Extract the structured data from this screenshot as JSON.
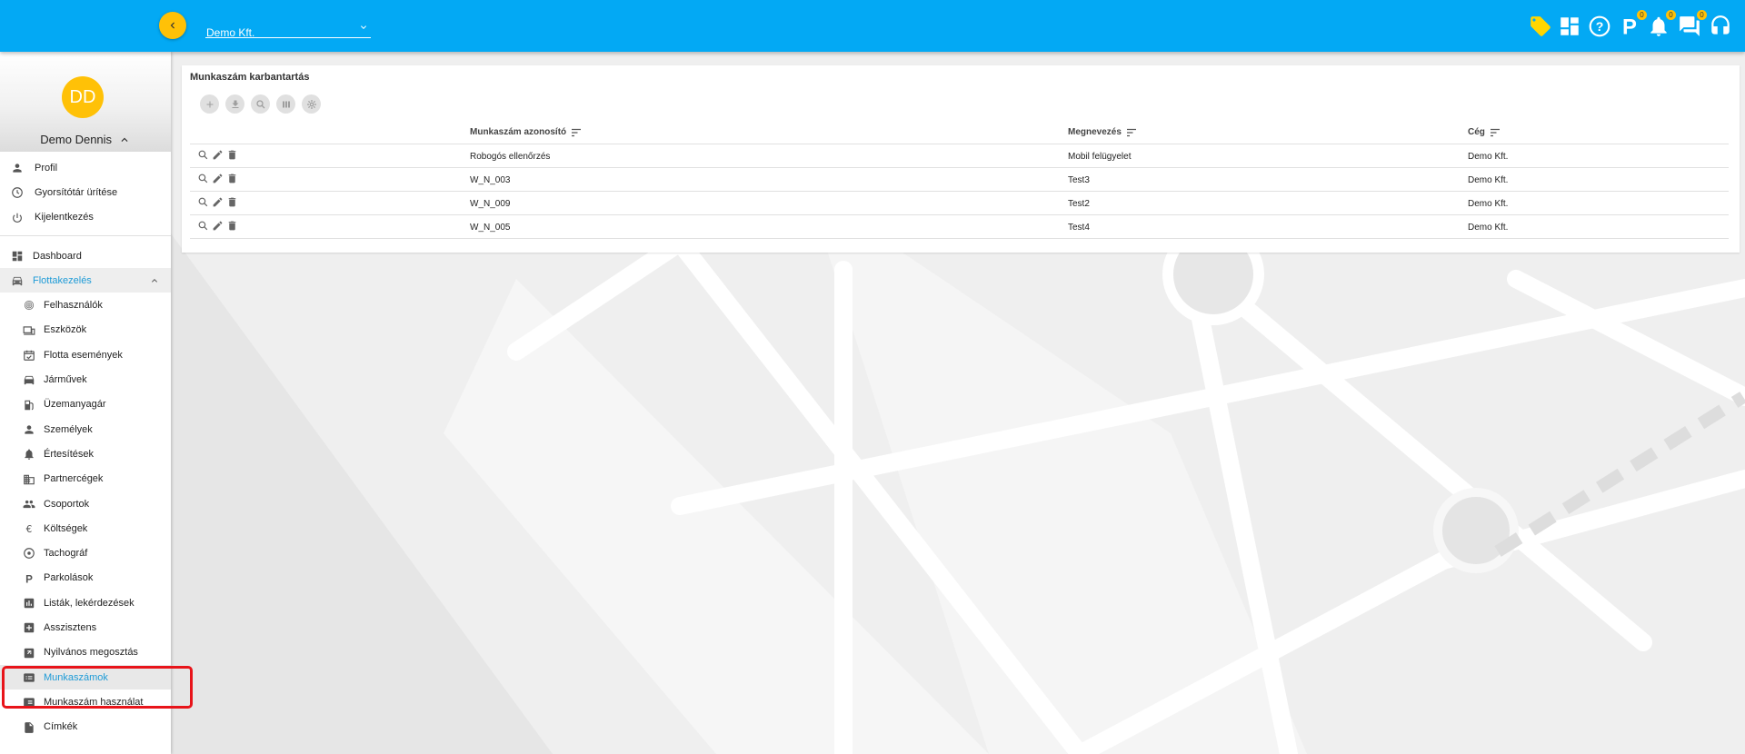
{
  "header": {
    "company_value": "Demo Kft.",
    "badges": {
      "parking": "0",
      "notifications": "0",
      "messages": "0"
    },
    "accent_color": "#03a9f4",
    "highlight_color": "#ffc107"
  },
  "user": {
    "initials": "DD",
    "name": "Demo Dennis"
  },
  "sidebar": {
    "account_items": [
      {
        "label": "Profil",
        "icon": "person-icon"
      },
      {
        "label": "Gyorsítótár ürítése",
        "icon": "clock-icon"
      },
      {
        "label": "Kijelentkezés",
        "icon": "power-icon"
      }
    ],
    "dashboard": "Dashboard",
    "section_title": "Flottakezelés",
    "items": [
      {
        "label": "Felhasználók",
        "icon": "fingerprint-icon"
      },
      {
        "label": "Eszközök",
        "icon": "devices-icon"
      },
      {
        "label": "Flotta események",
        "icon": "calendar-check-icon"
      },
      {
        "label": "Járművek",
        "icon": "car-icon"
      },
      {
        "label": "Üzemanyagár",
        "icon": "fuel-icon"
      },
      {
        "label": "Személyek",
        "icon": "person-icon"
      },
      {
        "label": "Értesítések",
        "icon": "alarm-icon"
      },
      {
        "label": "Partnercégek",
        "icon": "business-icon"
      },
      {
        "label": "Csoportok",
        "icon": "group-icon"
      },
      {
        "label": "Költségek",
        "icon": "euro-icon"
      },
      {
        "label": "Tachográf",
        "icon": "tachograph-icon"
      },
      {
        "label": "Parkolások",
        "icon": "parking-icon"
      },
      {
        "label": "Listák, lekérdezések",
        "icon": "chart-icon"
      },
      {
        "label": "Asszisztens",
        "icon": "plus-box-icon"
      },
      {
        "label": "Nyilvános megosztás",
        "icon": "share-icon"
      },
      {
        "label": "Munkaszámok",
        "icon": "work-icon"
      },
      {
        "label": "Munkaszám használat",
        "icon": "work-usage-icon"
      },
      {
        "label": "Címkék",
        "icon": "file-icon"
      }
    ]
  },
  "page": {
    "title": "Munkaszám karbantartás",
    "columns": [
      "Munkaszám azonosító",
      "Megnevezés",
      "Cég"
    ],
    "rows": [
      [
        "Robogós ellenőrzés",
        "Mobil felügyelet",
        "Demo Kft."
      ],
      [
        "W_N_003",
        "Test3",
        "Demo Kft."
      ],
      [
        "W_N_009",
        "Test2",
        "Demo Kft."
      ],
      [
        "W_N_005",
        "Test4",
        "Demo Kft."
      ]
    ]
  }
}
